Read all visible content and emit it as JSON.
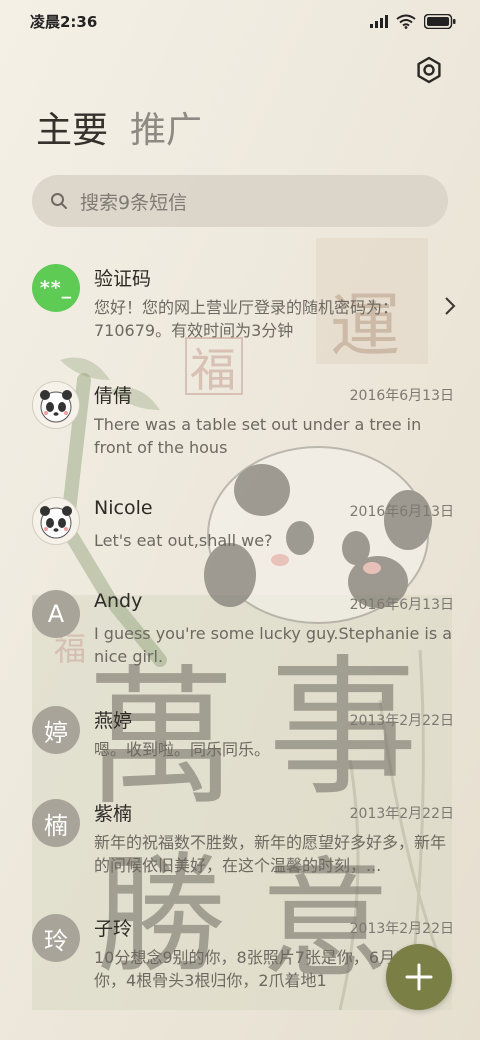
{
  "status_bar": {
    "time": "凌晨2:36"
  },
  "tabs": [
    {
      "label": "主要",
      "active": true
    },
    {
      "label": "推广",
      "active": false
    }
  ],
  "search": {
    "placeholder": "搜索9条短信"
  },
  "conversations": [
    {
      "name": "验证码",
      "avatar_text": "**_",
      "avatar_type": "green",
      "date": "",
      "preview": "您好！您的网上营业厅登录的随机密码为：710679。有效时间为3分钟",
      "has_chevron": true
    },
    {
      "name": "倩倩",
      "avatar_type": "panda",
      "date": "2016年6月13日",
      "preview": "There was a table set out under a tree in front of the hous"
    },
    {
      "name": "Nicole",
      "avatar_type": "panda",
      "date": "2016年6月13日",
      "preview": "Let's eat out,shall we?"
    },
    {
      "name": "Andy",
      "avatar_text": "A",
      "avatar_type": "letter",
      "date": "2016年6月13日",
      "preview": "I guess you're some lucky guy.Stephanie is a nice girl."
    },
    {
      "name": "燕婷",
      "avatar_text": "婷",
      "avatar_type": "letter",
      "date": "2013年2月22日",
      "preview": "嗯。收到啦。同乐同乐。"
    },
    {
      "name": "紫楠",
      "avatar_text": "楠",
      "avatar_type": "letter",
      "date": "2013年2月22日",
      "preview": "新年的祝福数不胜数，新年的愿望好多好多，新年的问候依旧美好，在这个温馨的时刻，..."
    },
    {
      "name": "子玲",
      "avatar_text": "玲",
      "avatar_type": "letter",
      "date": "2013年2月22日",
      "preview": "10分想念9别的你，8张照片7张是你，6月5只像你，4根骨头3根归你，2爪着地1...",
      "preview_cut": "10分想念9别的你，8张照片7张是你，6月5只像你，4根骨头3根归你，2爪着地1"
    }
  ],
  "icons": {
    "settings": "settings-gear-icon",
    "search": "search-icon",
    "fab": "plus-icon",
    "chevron": "chevron-right-icon"
  },
  "colors": {
    "background": "#ece6d9",
    "fab": "#7a7f45",
    "avatar_green": "#5ecb55",
    "avatar_letter": "#a8a499"
  },
  "wallpaper_text": [
    "萬",
    "事",
    "勝",
    "意",
    "福",
    "運"
  ]
}
